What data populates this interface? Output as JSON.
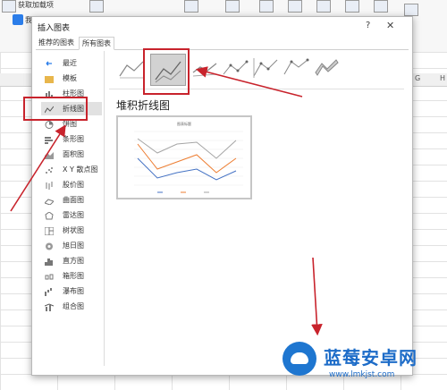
{
  "ribbon": {
    "items": [
      "获取加载项",
      "我"
    ]
  },
  "columns": [
    "G",
    "H"
  ],
  "dialog": {
    "title": "插入图表",
    "help": "?",
    "close": "✕",
    "tabs": [
      "推荐的图表",
      "所有图表"
    ],
    "active_tab": "所有图表",
    "categories": [
      {
        "label": "最近",
        "icon": "recent-icon"
      },
      {
        "label": "模板",
        "icon": "folder-icon"
      },
      {
        "label": "柱形图",
        "icon": "column-chart-icon"
      },
      {
        "label": "折线图",
        "icon": "line-chart-icon"
      },
      {
        "label": "饼图",
        "icon": "pie-chart-icon"
      },
      {
        "label": "条形图",
        "icon": "bar-chart-icon"
      },
      {
        "label": "面积图",
        "icon": "area-chart-icon"
      },
      {
        "label": "X Y 散点图",
        "icon": "scatter-chart-icon"
      },
      {
        "label": "股价图",
        "icon": "stock-chart-icon"
      },
      {
        "label": "曲面图",
        "icon": "surface-chart-icon"
      },
      {
        "label": "雷达图",
        "icon": "radar-chart-icon"
      },
      {
        "label": "树状图",
        "icon": "treemap-icon"
      },
      {
        "label": "旭日图",
        "icon": "sunburst-icon"
      },
      {
        "label": "直方图",
        "icon": "histogram-icon"
      },
      {
        "label": "箱形图",
        "icon": "box-whisker-icon"
      },
      {
        "label": "瀑布图",
        "icon": "waterfall-icon"
      },
      {
        "label": "组合图",
        "icon": "combo-chart-icon"
      }
    ],
    "selected_category": "折线图",
    "subtypes": [
      "line",
      "stacked-line",
      "percent-stacked-line",
      "line-markers",
      "stacked-line-markers",
      "percent-stacked-line-markers",
      "3d-line"
    ],
    "selected_subtype": "stacked-line",
    "pane_title": "堆积折线图",
    "preview": {
      "title": "图表标题",
      "series_colors": [
        "#4472c4",
        "#ed7d31",
        "#a5a5a5"
      ]
    }
  },
  "watermark": {
    "name": "蓝莓安卓网",
    "url": "www.lmkjst.com"
  },
  "colors": {
    "annotation_red": "#c8232c",
    "selection_gray": "#d2d2d2"
  }
}
